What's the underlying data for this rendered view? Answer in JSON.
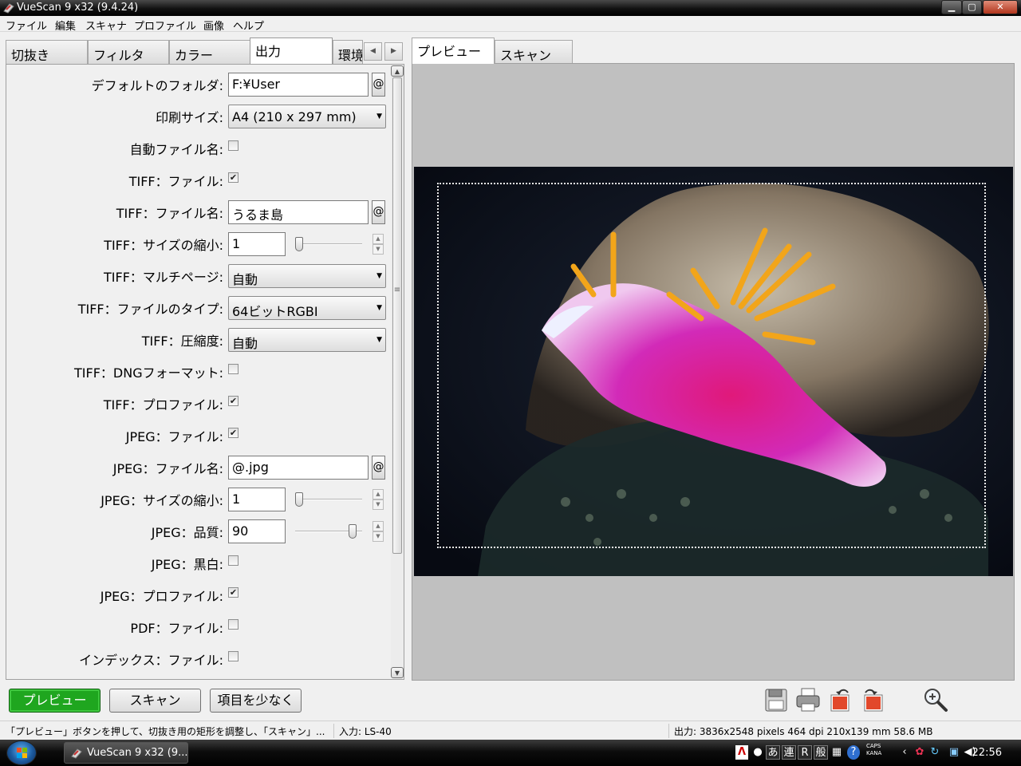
{
  "window": {
    "title": "VueScan 9 x32 (9.4.24)",
    "min": "▁",
    "max": "▢",
    "close": "✕"
  },
  "menu": [
    "ファイル",
    "編集",
    "スキャナ",
    "プロファイル",
    "画像",
    "ヘルプ"
  ],
  "left_tabs": [
    "切抜き",
    "フィルタ",
    "カラー",
    "出力",
    "環境"
  ],
  "active_left_tab": "出力",
  "tab_arrows": {
    "prev": "◀",
    "next": "▶"
  },
  "scroll": {
    "up": "▲",
    "down": "▼",
    "grip": "≡"
  },
  "settings": {
    "default_folder": {
      "label": "デフォルトのフォルダ:",
      "value": "F:¥User",
      "at": "@"
    },
    "print_size": {
      "label": "印刷サイズ:",
      "value": "A4 (210 x 297 mm)"
    },
    "auto_filename": {
      "label": "自動ファイル名:",
      "checked": false
    },
    "tiff_file": {
      "label": "TIFF：ファイル:",
      "checked": true
    },
    "tiff_filename": {
      "label": "TIFF：ファイル名:",
      "value": "うるま島",
      "at": "@"
    },
    "tiff_reduce": {
      "label": "TIFF：サイズの縮小:",
      "value": "1",
      "level": 0
    },
    "tiff_multipage": {
      "label": "TIFF：マルチページ:",
      "value": "自動"
    },
    "tiff_filetype": {
      "label": "TIFF：ファイルのタイプ:",
      "value": "64ビットRGBI"
    },
    "tiff_compression": {
      "label": "TIFF：圧縮度:",
      "value": "自動"
    },
    "tiff_dng": {
      "label": "TIFF：DNGフォーマット:",
      "checked": false
    },
    "tiff_profile": {
      "label": "TIFF：プロファイル:",
      "checked": true
    },
    "jpeg_file": {
      "label": "JPEG：ファイル:",
      "checked": true
    },
    "jpeg_filename": {
      "label": "JPEG：ファイル名:",
      "value": "@.jpg",
      "at": "@"
    },
    "jpeg_reduce": {
      "label": "JPEG：サイズの縮小:",
      "value": "1",
      "level": 0
    },
    "jpeg_quality": {
      "label": "JPEG：品質:",
      "value": "90",
      "level": 0.9
    },
    "jpeg_bw": {
      "label": "JPEG：黒白:",
      "checked": false
    },
    "jpeg_profile": {
      "label": "JPEG：プロファイル:",
      "checked": true
    },
    "pdf_file": {
      "label": "PDF：ファイル:",
      "checked": false
    },
    "index_file": {
      "label": "インデックス：ファイル:",
      "checked": false
    }
  },
  "right_tabs": [
    "プレビュー",
    "スキャン"
  ],
  "active_right_tab": "プレビュー",
  "buttons": {
    "preview": "プレビュー",
    "scan": "スキャン",
    "fewer_options": "項目を少なく"
  },
  "toolbar_icons": [
    "save-icon",
    "print-icon",
    "rotate-left-icon",
    "rotate-right-icon",
    "zoom-icon"
  ],
  "status": {
    "hint": "「プレビュー」ボタンを押して、切抜き用の矩形を調整し、「スキャン」...",
    "input": "入力: LS-40",
    "output": "出力: 3836x2548 pixels 464 dpi 210x139 mm 58.6 MB"
  },
  "taskbar": {
    "task": "VueScan 9 x32 (9...",
    "tray": [
      "あ",
      "連",
      "R",
      "般",
      "?"
    ],
    "caps": "CAPS",
    "kana": "KANA",
    "time": "22:56"
  },
  "colors": {
    "accent_green": "#1fa61f",
    "preview_bg": "#c0c0c0",
    "titlebar": "#000000"
  }
}
